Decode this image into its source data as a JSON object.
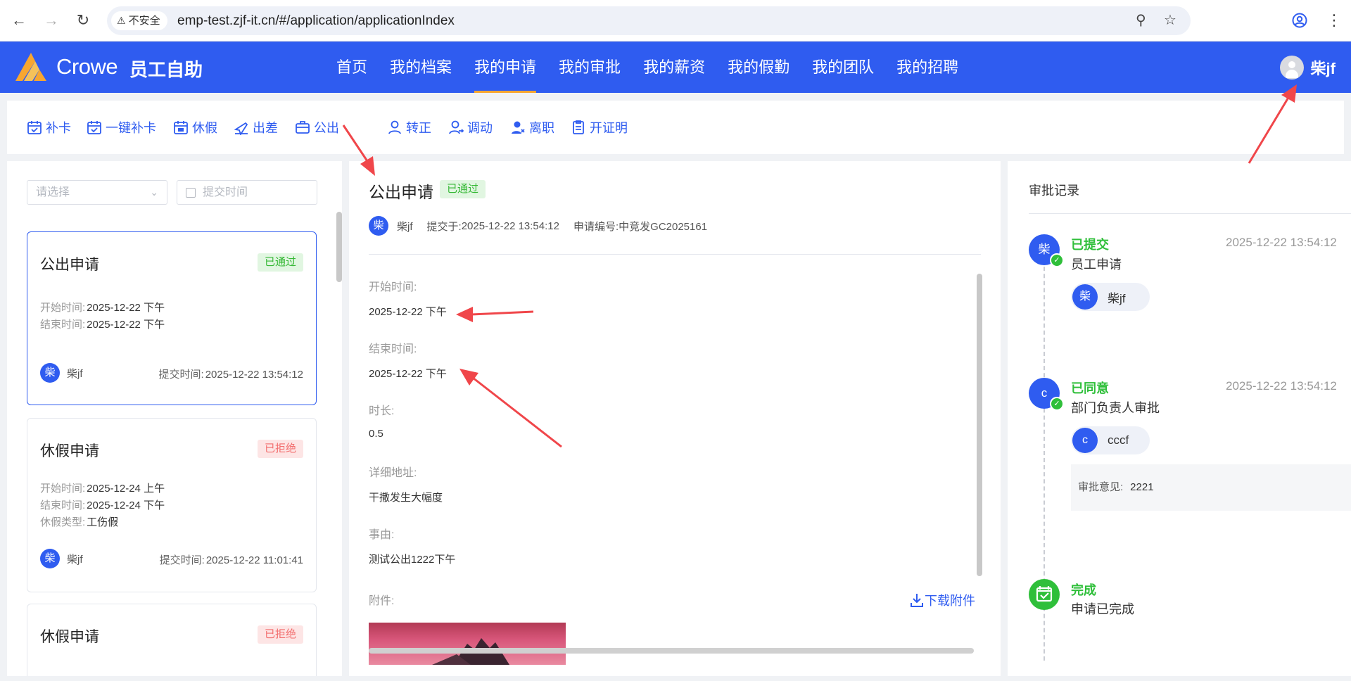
{
  "browser": {
    "insecure_label": "不安全",
    "url": "emp-test.zjf-it.cn/#/application/applicationIndex"
  },
  "header": {
    "brand": "Crowe",
    "subtitle": "员工自助",
    "brand_color": "#2f5cf0",
    "nav": [
      {
        "label": "首页"
      },
      {
        "label": "我的档案"
      },
      {
        "label": "我的申请",
        "active": true
      },
      {
        "label": "我的审批"
      },
      {
        "label": "我的薪资"
      },
      {
        "label": "我的假勤"
      },
      {
        "label": "我的团队"
      },
      {
        "label": "我的招聘"
      }
    ],
    "user_name": "柴jf"
  },
  "actions": [
    {
      "label": "补卡",
      "icon": "calendar-check-icon"
    },
    {
      "label": "一键补卡",
      "icon": "calendar-check-icon"
    },
    {
      "label": "休假",
      "icon": "calendar-leave-icon"
    },
    {
      "label": "出差",
      "icon": "plane-icon"
    },
    {
      "label": "公出",
      "icon": "briefcase-icon"
    },
    {
      "label": "转正",
      "icon": "user-icon"
    },
    {
      "label": "调动",
      "icon": "user-transfer-icon"
    },
    {
      "label": "离职",
      "icon": "user-leave-icon"
    },
    {
      "label": "开证明",
      "icon": "document-icon"
    }
  ],
  "filters": {
    "select_placeholder": "请选择",
    "date_placeholder": "提交时间"
  },
  "cards": [
    {
      "title": "公出申请",
      "status": "已通过",
      "lines": [
        {
          "label": "开始时间:",
          "value": "2025-12-22 下午"
        },
        {
          "label": "结束时间:",
          "value": "2025-12-22 下午"
        }
      ],
      "avatar": "柴",
      "user": "柴jf",
      "submit_label": "提交时间:",
      "submit_time": "2025-12-22 13:54:12"
    },
    {
      "title": "休假申请",
      "status": "已拒绝",
      "lines": [
        {
          "label": "开始时间:",
          "value": "2025-12-24 上午"
        },
        {
          "label": "结束时间:",
          "value": "2025-12-24 下午"
        },
        {
          "label": "休假类型:",
          "value": "工伤假"
        }
      ],
      "avatar": "柴",
      "user": "柴jf",
      "submit_label": "提交时间:",
      "submit_time": "2025-12-22 11:01:41"
    },
    {
      "title": "休假申请",
      "status": "已拒绝"
    }
  ],
  "detail": {
    "title": "公出申请",
    "status": "已通过",
    "avatar": "柴",
    "user": "柴jf",
    "submitted_label": "提交于:",
    "submitted_time": "2025-12-22 13:54:12",
    "number_label": "申请编号:",
    "number": "中竞发GC2025161",
    "fields": [
      {
        "label": "开始时间:",
        "value": "2025-12-22 下午"
      },
      {
        "label": "结束时间:",
        "value": "2025-12-22 下午"
      },
      {
        "label": "时长:",
        "value": "0.5"
      },
      {
        "label": "详细地址:",
        "value": "干撒发生大幅度"
      },
      {
        "label": "事由:",
        "value": "测试公出1222下午"
      }
    ],
    "attachment_label": "附件:",
    "download_label": "下载附件"
  },
  "approval": {
    "title": "审批记录",
    "steps": [
      {
        "status": "已提交",
        "time": "2025-12-22 13:54:12",
        "desc": "员工申请",
        "node": "柴",
        "chip_avatar": "柴",
        "chip_name": "柴jf"
      },
      {
        "status": "已同意",
        "time": "2025-12-22 13:54:12",
        "desc": "部门负责人审批",
        "node": "c",
        "chip_avatar": "c",
        "chip_name": "cccf",
        "opinion_label": "审批意见:",
        "opinion": "2221"
      },
      {
        "status": "完成",
        "desc": "申请已完成"
      }
    ]
  },
  "colors": {
    "success": "#2fbf3a",
    "reject": "#f26c6c",
    "accent": "#f7a630",
    "annotation": "#f0464a"
  }
}
